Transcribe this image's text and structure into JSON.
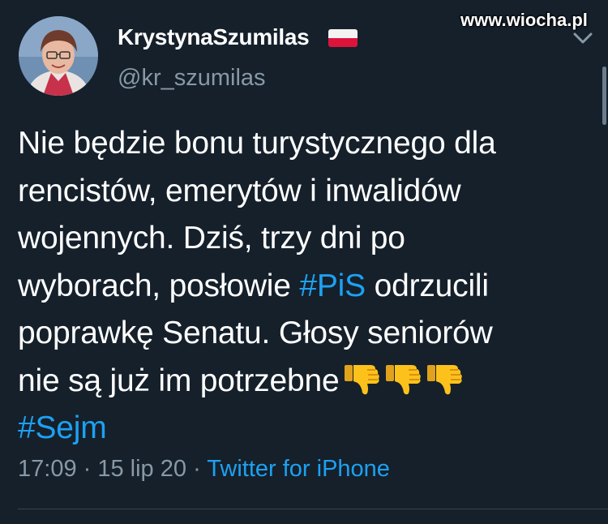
{
  "tweet": {
    "author": {
      "display_name": "KrystynaSzumilas",
      "handle": "@kr_szumilas",
      "flag": "poland-flag"
    },
    "text_lines": [
      "Nie będzie bonu turystycznego dla",
      "rencistów, emerytów i inwalidów",
      "wojennych. Dziś, trzy dni po"
    ],
    "line4_before": "wyborach, posłowie ",
    "hashtag_pis": "#PiS",
    "line4_after": " odrzucili",
    "line5": "poprawkę Senatu. Głosy seniorów",
    "line6": "nie są już im potrzebne",
    "emojis": [
      "thumbs-down-icon",
      "thumbs-down-icon",
      "thumbs-down-icon"
    ],
    "hashtag_sejm": "#Sejm",
    "time": "17:09",
    "sep1": " · ",
    "date": "15 lip 20",
    "sep2": " · ",
    "source": "Twitter for iPhone"
  },
  "watermark": "www.wiocha.pl",
  "colors": {
    "background": "#15202b",
    "text": "#ffffff",
    "secondary": "#8899a6",
    "link": "#1da1f2",
    "divider": "#38444d"
  }
}
